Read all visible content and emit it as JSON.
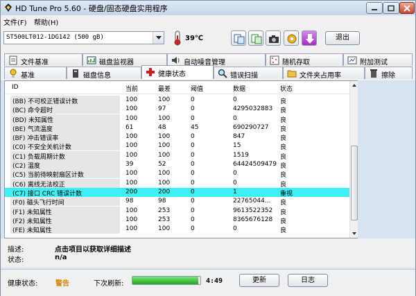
{
  "window": {
    "title": "HD Tune Pro 5.60 - 硬盘/固态硬盘实用程序"
  },
  "menu": {
    "file": "文件(F)",
    "help": "帮助(H)"
  },
  "toolbar": {
    "drive": "ST500LT012-1DG142 (500 gB)",
    "temperature": "39℃",
    "exit_label": "退出"
  },
  "tabs_top": [
    "文件基准",
    "磁盘监视器",
    "自动噪音管理",
    "随机存取",
    "附加测试"
  ],
  "tabs_bottom": [
    "基准",
    "磁盘信息",
    "健康状态",
    "错误扫描",
    "文件夹占用率",
    "擦除"
  ],
  "active_tab": "健康状态",
  "table": {
    "headers": [
      "ID",
      "当前",
      "最差",
      "阈值",
      "数据",
      "状态"
    ],
    "rows": [
      {
        "id": "(BB) 不可校正错误计数",
        "cur": "100",
        "worst": "100",
        "thr": "0",
        "data": "0",
        "status": "良"
      },
      {
        "id": "(BC) 命令超时",
        "cur": "100",
        "worst": "97",
        "thr": "0",
        "data": "4295032883",
        "status": "良"
      },
      {
        "id": "(BD) 未知属性",
        "cur": "100",
        "worst": "100",
        "thr": "0",
        "data": "0",
        "status": "良"
      },
      {
        "id": "(BE) 气流温度",
        "cur": "61",
        "worst": "48",
        "thr": "45",
        "data": "690290727",
        "status": "良"
      },
      {
        "id": "(BF) 冲击错误率",
        "cur": "100",
        "worst": "100",
        "thr": "0",
        "data": "847",
        "status": "良"
      },
      {
        "id": "(C0) 不安全关机计数",
        "cur": "100",
        "worst": "100",
        "thr": "0",
        "data": "15",
        "status": "良"
      },
      {
        "id": "(C1) 负载周期计数",
        "cur": "100",
        "worst": "100",
        "thr": "0",
        "data": "1519",
        "status": "良"
      },
      {
        "id": "(C2) 温度",
        "cur": "39",
        "worst": "52",
        "thr": "0",
        "data": "64424509479",
        "status": "良"
      },
      {
        "id": "(C5) 当前待映射扇区计数",
        "cur": "100",
        "worst": "100",
        "thr": "0",
        "data": "0",
        "status": "良"
      },
      {
        "id": "(C6) 离线无法校正",
        "cur": "100",
        "worst": "100",
        "thr": "0",
        "data": "0",
        "status": "良"
      },
      {
        "id": "(C7) 接口 CRC 错误计数",
        "cur": "200",
        "worst": "200",
        "thr": "0",
        "data": "1",
        "status": "重视"
      },
      {
        "id": "(F0) 磁头飞行时间",
        "cur": "98",
        "worst": "98",
        "thr": "0",
        "data": "22765044...",
        "status": "良"
      },
      {
        "id": "(F1) 未知属性",
        "cur": "100",
        "worst": "253",
        "thr": "0",
        "data": "9613522352",
        "status": "良"
      },
      {
        "id": "(F2) 未知属性",
        "cur": "100",
        "worst": "253",
        "thr": "0",
        "data": "8365676128",
        "status": "良"
      },
      {
        "id": "(FE) 未知属性",
        "cur": "100",
        "worst": "100",
        "thr": "0",
        "data": "0",
        "status": "良"
      }
    ],
    "selected_index": 10
  },
  "details": {
    "desc_label": "描述:",
    "desc_value": "点击项目以获取详细描述",
    "state_label": "状态:",
    "state_value": "n/a"
  },
  "status": {
    "health_label": "健康状态:",
    "health_value": "警告",
    "refresh_label": "下次刷新:",
    "progress": 0.97,
    "countdown": "4:49",
    "refresh_button": "更新",
    "log_button": "日志"
  },
  "colors": {
    "selected_row": "#3cf0f5",
    "warning": "#d18a00",
    "progress": "#1ea71e"
  }
}
